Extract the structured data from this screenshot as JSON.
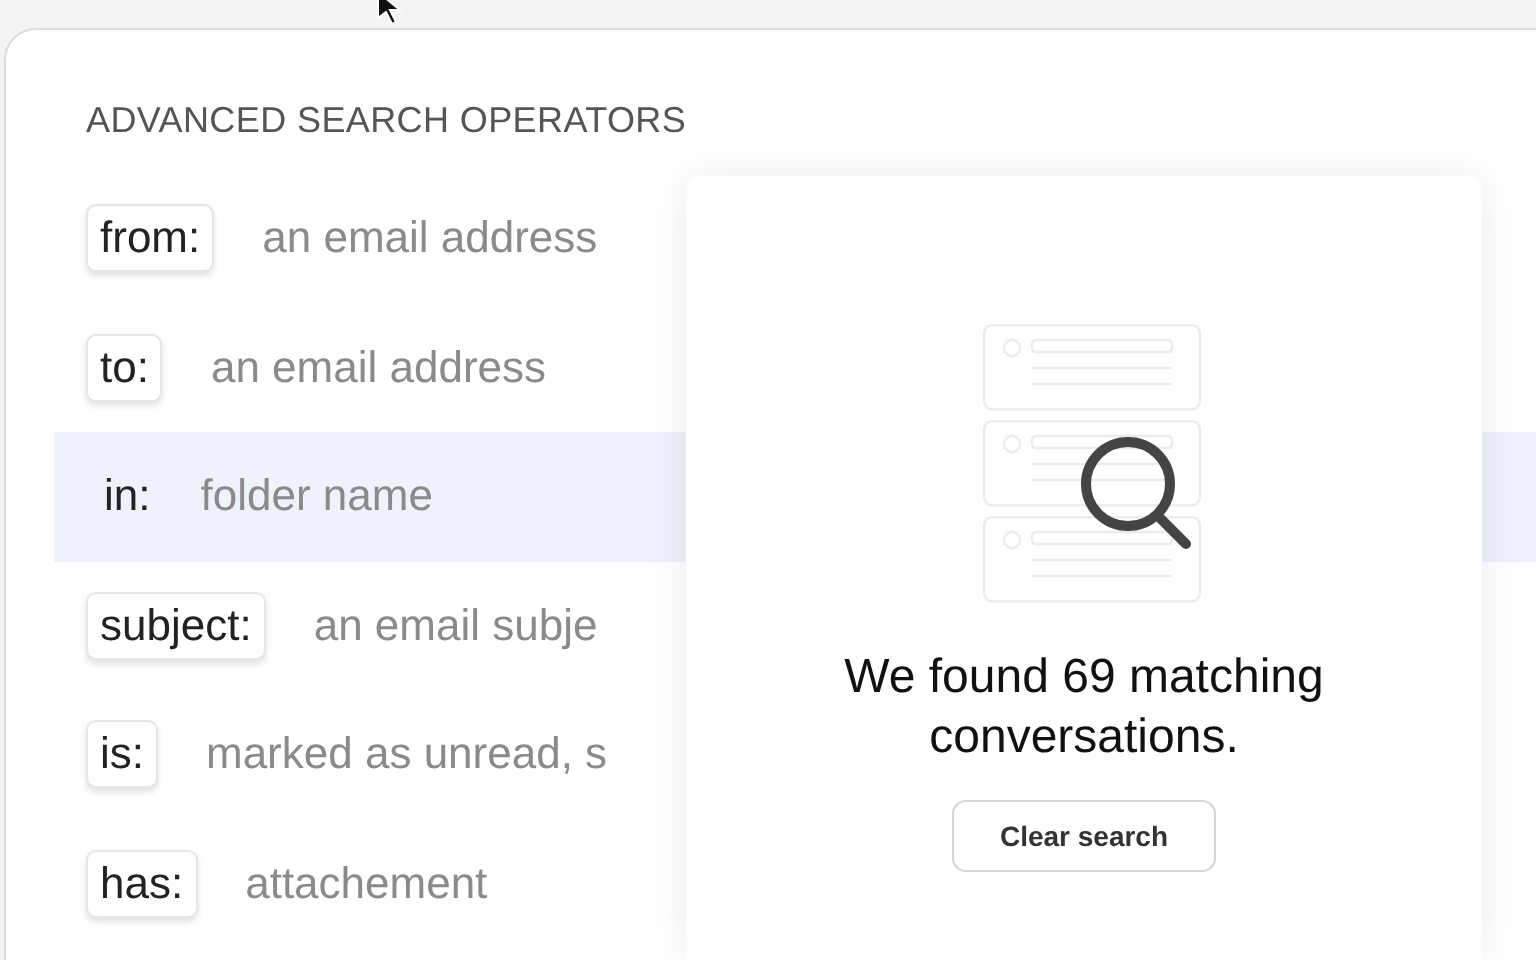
{
  "heading": "ADVANCED SEARCH OPERATORS",
  "operators": [
    {
      "key": "from:",
      "description": "an email address",
      "selected": false
    },
    {
      "key": "to:",
      "description": "an email address",
      "selected": false
    },
    {
      "key": "in:",
      "description": "folder name",
      "selected": true
    },
    {
      "key": "subject:",
      "description": "an email subje",
      "selected": false
    },
    {
      "key": "is:",
      "description": "marked as unread, s",
      "selected": false
    },
    {
      "key": "has:",
      "description": "attachement",
      "selected": false
    }
  ],
  "results": {
    "message": "We found 69 matching conversations.",
    "button": "Clear search"
  }
}
